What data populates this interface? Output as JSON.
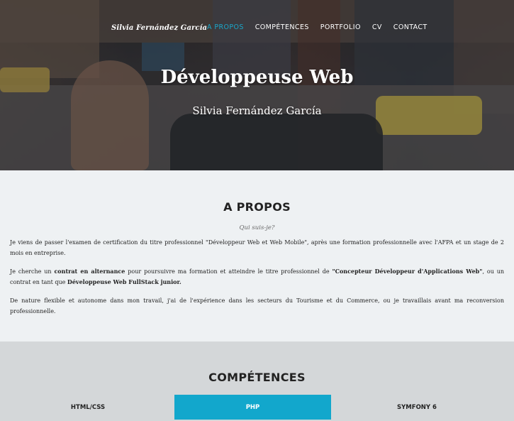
{
  "navbar": {
    "brand": "Silvia Fernández García",
    "items": [
      {
        "label": "A PROPOS",
        "active": true
      },
      {
        "label": "COMPÉTENCES",
        "active": false
      },
      {
        "label": "PORTFOLIO",
        "active": false
      },
      {
        "label": "CV",
        "active": false
      },
      {
        "label": "CONTACT",
        "active": false
      }
    ]
  },
  "hero": {
    "title": "Développeuse Web",
    "subtitle": "Silvia Fernández García"
  },
  "about": {
    "heading": "A PROPOS",
    "subheading": "Qui suis-je?",
    "p1": "Je viens de passer l'examen de certification du titre professionnel \"Développeur Web et Web Mobile\", après une formation professionnelle avec l'AFPA et un stage de 2 mois en entreprise.",
    "p2_a": "Je cherche un ",
    "p2_b": "contrat en alternance",
    "p2_c": " pour poursuivre ma formation et atteindre le titre professionnel de ",
    "p2_d": "\"Concepteur Développeur d'Applications Web\"",
    "p2_e": ", ou un contrat en tant que ",
    "p2_f": "Développeuse Web FullStack junior.",
    "p3": "De nature flexible et autonome dans mon travail, j'ai de l'expérience dans les secteurs du Tourisme et du Commerce, ou je travaillais avant ma reconversion professionnelle."
  },
  "competences": {
    "heading": "COMPÉTENCES",
    "tabs": [
      {
        "label": "HTML/CSS",
        "active": false
      },
      {
        "label": "PHP",
        "active": true
      },
      {
        "label": "SYMFONY 6",
        "active": false
      }
    ]
  },
  "colors": {
    "accent": "#12a7cc",
    "about_bg": "#eef1f3",
    "competences_bg": "#d4d7d9"
  }
}
